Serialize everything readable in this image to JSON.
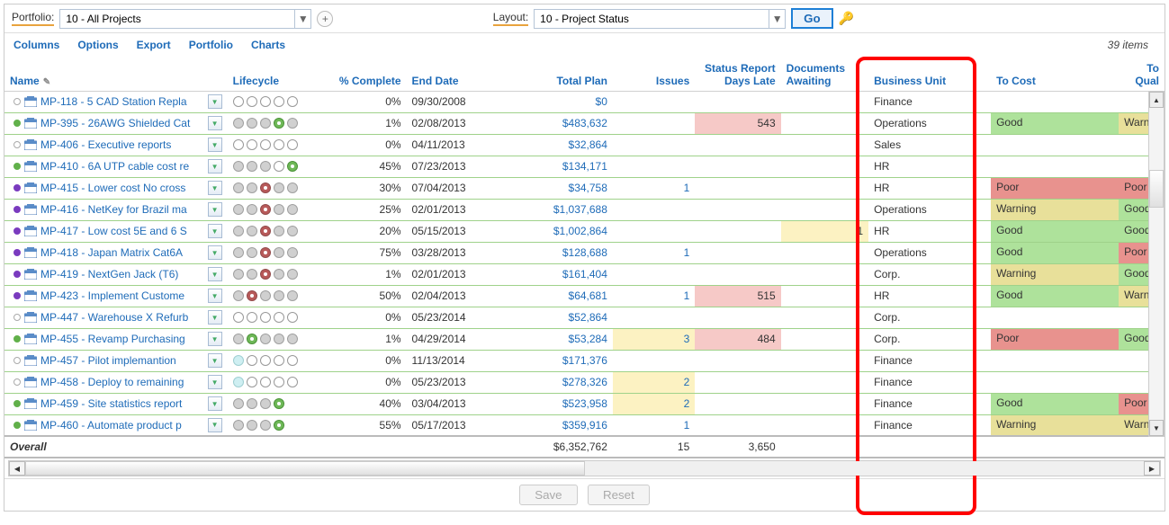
{
  "toolbar": {
    "portfolio_label": "Portfolio:",
    "portfolio_value": "10 - All Projects",
    "layout_label": "Layout:",
    "layout_value": "10 - Project Status",
    "go_label": "Go"
  },
  "menu": {
    "columns": "Columns",
    "options": "Options",
    "export": "Export",
    "portfolio": "Portfolio",
    "charts": "Charts",
    "items_count": "39 items"
  },
  "columns": {
    "name": "Name",
    "lifecycle": "Lifecycle",
    "pct": "% Complete",
    "end": "End Date",
    "plan": "Total Plan",
    "issues": "Issues",
    "days_late": "Status Report Days Late",
    "docs": "Documents Awaiting",
    "bu": "Business Unit",
    "cost": "To Cost",
    "qual": "To Qual"
  },
  "rows": [
    {
      "state": "idle",
      "name": "MP-118 - 5 CAD Station Repla",
      "life": [
        "empty",
        "empty",
        "empty",
        "empty",
        "empty"
      ],
      "pct": "0%",
      "end": "09/30/2008",
      "plan": "$0",
      "issues": "",
      "days_late": "",
      "days_bg": "",
      "docs": "",
      "bu": "Finance",
      "cost": "",
      "qual": ""
    },
    {
      "state": "prog",
      "name": "MP-395 - 26AWG Shielded Cat",
      "life": [
        "skip",
        "skip",
        "skip",
        "done",
        "skip"
      ],
      "pct": "1%",
      "end": "02/08/2013",
      "plan": "$483,632",
      "issues": "",
      "days_late": "543",
      "days_bg": "hl-red",
      "docs": "",
      "bu": "Operations",
      "cost": "Good",
      "qual": "Warning"
    },
    {
      "state": "idle",
      "name": "MP-406 - Executive reports",
      "life": [
        "empty",
        "empty",
        "empty",
        "empty",
        "empty"
      ],
      "pct": "0%",
      "end": "04/11/2013",
      "plan": "$32,864",
      "issues": "",
      "days_late": "",
      "days_bg": "",
      "docs": "",
      "bu": "Sales",
      "cost": "",
      "qual": ""
    },
    {
      "state": "prog",
      "name": "MP-410 - 6A UTP cable cost re",
      "life": [
        "skip",
        "skip",
        "skip",
        "",
        "done"
      ],
      "pct": "45%",
      "end": "07/23/2013",
      "plan": "$134,171",
      "issues": "",
      "days_late": "",
      "days_bg": "",
      "docs": "",
      "bu": "HR",
      "cost": "",
      "qual": ""
    },
    {
      "state": "risk",
      "name": "MP-415 - Lower cost No cross",
      "life": [
        "skip",
        "skip",
        "risk",
        "skip",
        "skip"
      ],
      "pct": "30%",
      "end": "07/04/2013",
      "plan": "$34,758",
      "issues": "1",
      "days_late": "",
      "days_bg": "",
      "docs": "",
      "bu": "HR",
      "cost": "Poor",
      "qual": "Poor"
    },
    {
      "state": "risk",
      "name": "MP-416 - NetKey for Brazil ma",
      "life": [
        "skip",
        "skip",
        "risk",
        "skip",
        "skip"
      ],
      "pct": "25%",
      "end": "02/01/2013",
      "plan": "$1,037,688",
      "issues": "",
      "days_late": "",
      "days_bg": "",
      "docs": "",
      "bu": "Operations",
      "cost": "Warning",
      "qual": "Good"
    },
    {
      "state": "risk",
      "name": "MP-417 - Low cost 5E and 6 S",
      "life": [
        "skip",
        "skip",
        "risk",
        "skip",
        "skip"
      ],
      "pct": "20%",
      "end": "05/15/2013",
      "plan": "$1,002,864",
      "issues": "",
      "days_late": "",
      "days_bg": "",
      "docs": "1",
      "docs_bg": "hl-yellow",
      "bu": "HR",
      "cost": "Good",
      "qual": "Good"
    },
    {
      "state": "risk",
      "name": "MP-418 - Japan Matrix Cat6A",
      "life": [
        "skip",
        "skip",
        "risk",
        "skip",
        "skip"
      ],
      "pct": "75%",
      "end": "03/28/2013",
      "plan": "$128,688",
      "issues": "1",
      "days_late": "",
      "days_bg": "",
      "docs": "",
      "bu": "Operations",
      "cost": "Good",
      "qual": "Poor"
    },
    {
      "state": "risk",
      "name": "MP-419 - NextGen Jack (T6)",
      "life": [
        "skip",
        "skip",
        "risk",
        "skip",
        "skip"
      ],
      "pct": "1%",
      "end": "02/01/2013",
      "plan": "$161,404",
      "issues": "",
      "days_late": "",
      "days_bg": "",
      "docs": "",
      "bu": "Corp.",
      "cost": "Warning",
      "qual": "Good"
    },
    {
      "state": "risk",
      "name": "MP-423 - Implement Custome",
      "life": [
        "skip",
        "risk",
        "skip",
        "skip",
        "skip"
      ],
      "pct": "50%",
      "end": "02/04/2013",
      "plan": "$64,681",
      "issues": "1",
      "days_late": "515",
      "days_bg": "hl-red",
      "docs": "",
      "bu": "HR",
      "cost": "Good",
      "qual": "Warning"
    },
    {
      "state": "idle",
      "name": "MP-447 - Warehouse X Refurb",
      "life": [
        "empty",
        "empty",
        "empty",
        "empty",
        "empty"
      ],
      "pct": "0%",
      "end": "05/23/2014",
      "plan": "$52,864",
      "issues": "",
      "days_late": "",
      "days_bg": "",
      "docs": "",
      "bu": "Corp.",
      "cost": "",
      "qual": ""
    },
    {
      "state": "prog",
      "name": "MP-455 - Revamp Purchasing",
      "life": [
        "skip",
        "done",
        "skip",
        "skip",
        "skip"
      ],
      "pct": "1%",
      "end": "04/29/2014",
      "plan": "$53,284",
      "issues": "3",
      "issues_bg": "hl-yellow",
      "days_late": "484",
      "days_bg": "hl-red",
      "docs": "",
      "bu": "Corp.",
      "cost": "Poor",
      "qual": "Good"
    },
    {
      "state": "idle",
      "name": "MP-457 - Pilot implemantion",
      "life": [
        "cyan",
        "",
        "empty",
        "",
        "empty"
      ],
      "pct": "0%",
      "end": "11/13/2014",
      "plan": "$171,376",
      "issues": "",
      "days_late": "",
      "days_bg": "",
      "docs": "",
      "bu": "Finance",
      "cost": "",
      "qual": ""
    },
    {
      "state": "idle",
      "name": "MP-458 - Deploy to remaining",
      "life": [
        "cyan",
        "",
        "empty",
        "",
        "empty"
      ],
      "pct": "0%",
      "end": "05/23/2013",
      "plan": "$278,326",
      "issues": "2",
      "issues_bg": "hl-yellow",
      "days_late": "",
      "days_bg": "",
      "docs": "",
      "bu": "Finance",
      "cost": "",
      "qual": ""
    },
    {
      "state": "prog",
      "name": "MP-459 - Site statistics report",
      "life": [
        "skip",
        "skip",
        "skip",
        "done"
      ],
      "pct": "40%",
      "end": "03/04/2013",
      "plan": "$523,958",
      "issues": "2",
      "issues_bg": "hl-yellow",
      "days_late": "",
      "days_bg": "",
      "docs": "",
      "bu": "Finance",
      "cost": "Good",
      "qual": "Poor"
    },
    {
      "state": "prog",
      "name": "MP-460 - Automate product p",
      "life": [
        "skip",
        "skip",
        "skip",
        "done"
      ],
      "pct": "55%",
      "end": "05/17/2013",
      "plan": "$359,916",
      "issues": "1",
      "days_late": "",
      "days_bg": "",
      "docs": "",
      "bu": "Finance",
      "cost": "Warning",
      "qual": "Warning"
    }
  ],
  "overall": {
    "label": "Overall",
    "plan": "$6,352,762",
    "issues": "15",
    "days_late": "3,650"
  },
  "buttons": {
    "save": "Save",
    "reset": "Reset"
  }
}
